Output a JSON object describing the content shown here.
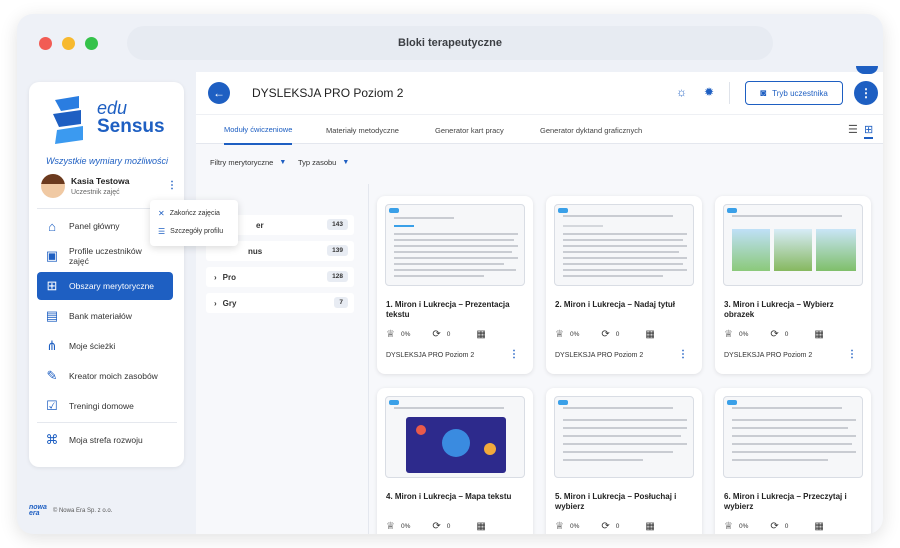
{
  "window": {
    "title": "Bloki terapeutyczne"
  },
  "sidebar": {
    "logo": {
      "line1": "edu",
      "line2": "Sensus"
    },
    "tagline": "Wszystkie wymiary możliwości",
    "user": {
      "name": "Kasia Testowa",
      "role": "Uczestnik zajęć"
    },
    "items": [
      {
        "label": "Panel główny",
        "icon": "home-icon"
      },
      {
        "label": "Profile uczestników zajęć",
        "icon": "id-card-icon"
      },
      {
        "label": "Obszary merytoryczne",
        "icon": "grid-icon"
      },
      {
        "label": "Bank materiałów",
        "icon": "box-icon"
      },
      {
        "label": "Moje ścieżki",
        "icon": "path-icon"
      },
      {
        "label": "Kreator moich zasobów",
        "icon": "pencil-icon"
      },
      {
        "label": "Treningi domowe",
        "icon": "checklist-icon"
      },
      {
        "label": "Moja strefa rozwoju",
        "icon": "graduation-cap-icon"
      }
    ],
    "active_index": 2
  },
  "popover": {
    "items": [
      "Zakończ zajęcia",
      "Szczegóły profilu"
    ]
  },
  "footer": {
    "brand_line1": "nowa",
    "brand_line2": "era",
    "copyright": "© Nowa Era Sp. z o.o."
  },
  "header": {
    "title": "DYSLEKSJA PRO Poziom 2",
    "mode_button": "Tryb uczestnika"
  },
  "tabs": [
    "Moduły ćwiczeniowe",
    "Materiały metodyczne",
    "Generator kart pracy",
    "Generator dyktand graficznych"
  ],
  "filters": [
    "Filtry merytoryczne",
    "Typ zasobu"
  ],
  "levels": [
    {
      "label": "er",
      "count": "143",
      "chevron": ""
    },
    {
      "label": "nus",
      "count": "139",
      "chevron": ""
    },
    {
      "label": "Pro",
      "count": "128",
      "chevron": "›"
    },
    {
      "label": "Gry",
      "count": "7",
      "chevron": "›"
    }
  ],
  "cards": [
    {
      "title": "1. Miron i Lukrecja – Prezentacja tekstu",
      "progress": "0%",
      "repeats": "0",
      "level": "DYSLEKSJA PRO Poziom 2"
    },
    {
      "title": "2. Miron i Lukrecja – Nadaj tytuł",
      "progress": "0%",
      "repeats": "0",
      "level": "DYSLEKSJA PRO Poziom 2"
    },
    {
      "title": "3. Miron i Lukrecja – Wybierz obrazek",
      "progress": "0%",
      "repeats": "0",
      "level": "DYSLEKSJA PRO Poziom 2"
    },
    {
      "title": "4. Miron i Lukrecja – Mapa tekstu",
      "progress": "0%",
      "repeats": "0",
      "level": "DYSLEKSJA PRO Poziom 2"
    },
    {
      "title": "5. Miron i Lukrecja – Posłuchaj i wybierz",
      "progress": "0%",
      "repeats": "0",
      "level": "DYSLEKSJA PRO Poziom 2"
    },
    {
      "title": "6. Miron i Lukrecja – Przeczytaj i wybierz",
      "progress": "0%",
      "repeats": "0",
      "level": "DYSLEKSJA PRO Poziom 2"
    }
  ],
  "colors": {
    "accent": "#1e5fc2",
    "window_bg": "#eef1f7"
  }
}
